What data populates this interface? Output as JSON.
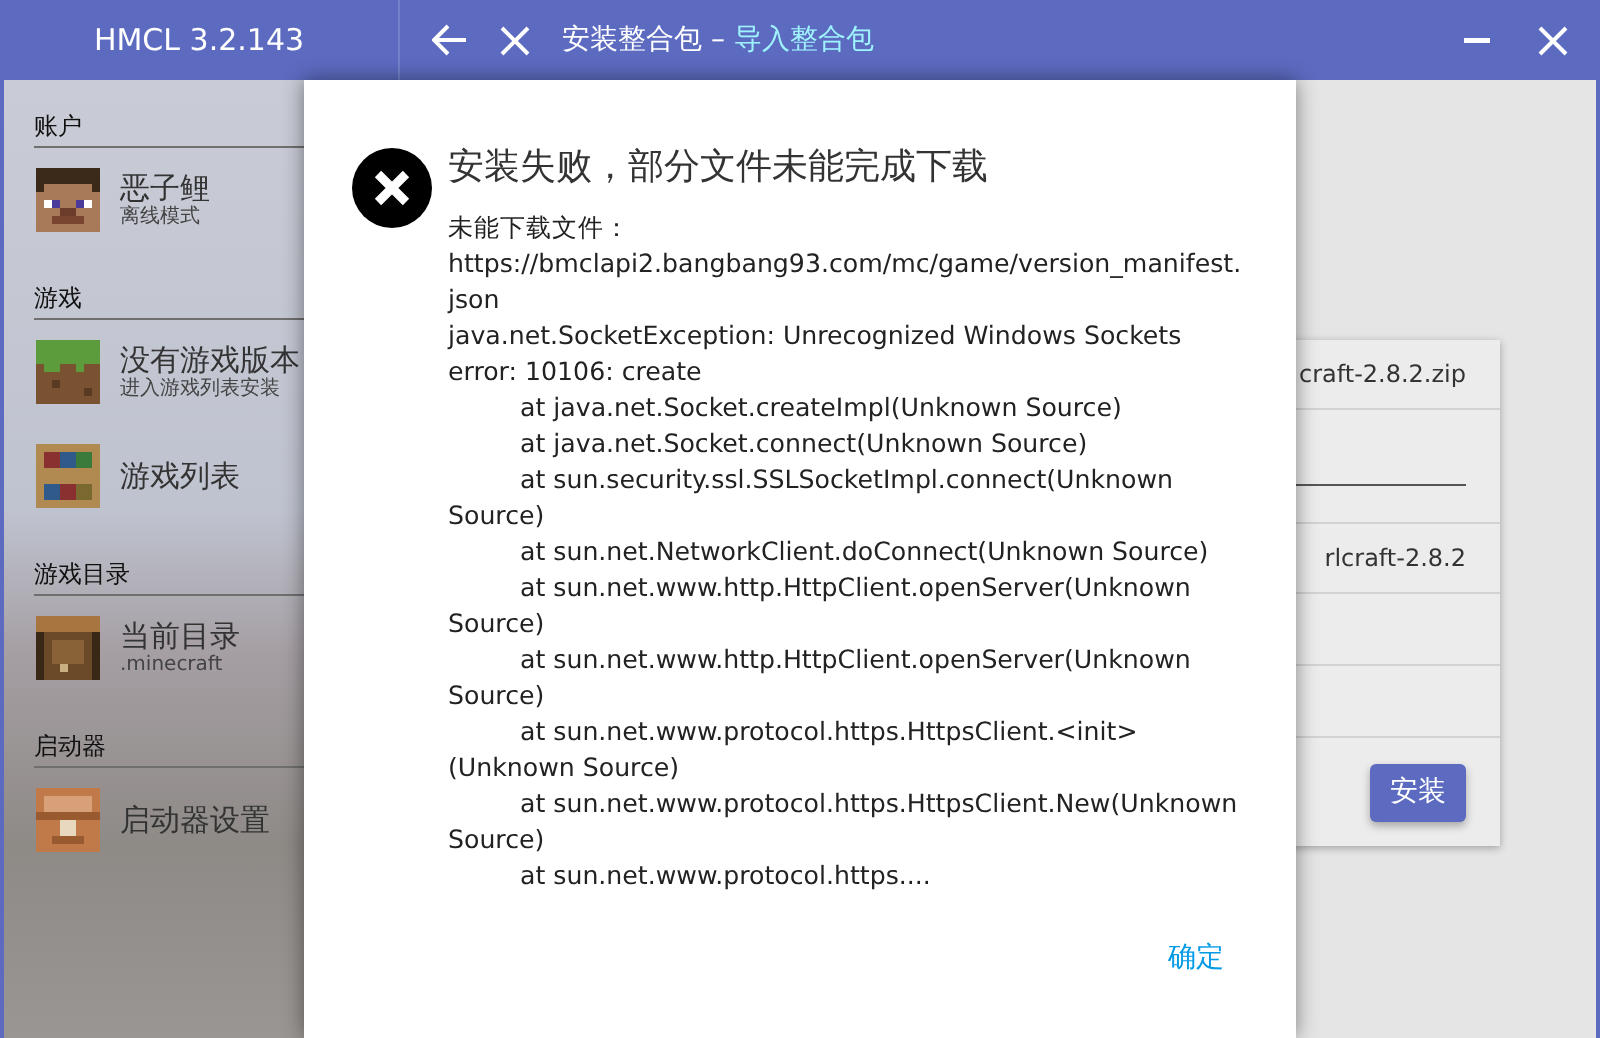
{
  "title_bar": {
    "app_name": "HMCL 3.2.143",
    "page_title": "安装整合包",
    "separator": "–",
    "subtitle": "导入整合包"
  },
  "sidebar": {
    "sections": [
      {
        "header": "账户",
        "items": [
          {
            "kind": "head",
            "title": "恶子鲤",
            "subtitle": "离线模式"
          }
        ]
      },
      {
        "header": "游戏",
        "items": [
          {
            "kind": "grass",
            "title": "没有游戏版本",
            "subtitle": "进入游戏列表安装"
          },
          {
            "kind": "bookshelf",
            "title": "游戏列表"
          }
        ]
      },
      {
        "header": "游戏目录",
        "items": [
          {
            "kind": "crate",
            "title": "当前目录",
            "subtitle": ".minecraft"
          }
        ]
      },
      {
        "header": "启动器",
        "items": [
          {
            "kind": "command",
            "title": "启动器设置"
          }
        ]
      }
    ]
  },
  "background_card": {
    "rows": [
      {
        "kind": "text",
        "value": "craft-2.8.2.zip"
      },
      {
        "kind": "field"
      },
      {
        "kind": "text",
        "value": "rlcraft-2.8.2"
      },
      {
        "kind": "empty"
      },
      {
        "kind": "empty"
      },
      {
        "kind": "button",
        "label": "安装"
      }
    ]
  },
  "dialog": {
    "title": "安装失败，部分文件未能完成下载",
    "lines": [
      {
        "text": "未能下载文件：https://bmclapi2.bangbang93.com/mc/game/version_manifest.json",
        "indented": false
      },
      {
        "text": "java.net.SocketException: Unrecognized Windows Sockets error: 10106: create",
        "indented": false
      },
      {
        "text": "at java.net.Socket.createImpl(Unknown Source)",
        "indented": true
      },
      {
        "text": "at java.net.Socket.connect(Unknown Source)",
        "indented": true
      },
      {
        "text": "at sun.security.ssl.SSLSocketImpl.connect(Unknown Source)",
        "indented": true
      },
      {
        "text": "at sun.net.NetworkClient.doConnect(Unknown Source)",
        "indented": true
      },
      {
        "text": "at sun.net.www.http.HttpClient.openServer(Unknown Source)",
        "indented": true
      },
      {
        "text": "at sun.net.www.http.HttpClient.openServer(Unknown Source)",
        "indented": true
      },
      {
        "text": "at sun.net.www.protocol.https.HttpsClient.<init>(Unknown Source)",
        "indented": true
      },
      {
        "text": "at sun.net.www.protocol.https.HttpsClient.New(Unknown Source)",
        "indented": true
      },
      {
        "text": "at sun.net.www.protocol.https....",
        "indented": true
      }
    ],
    "confirm": "确定"
  }
}
